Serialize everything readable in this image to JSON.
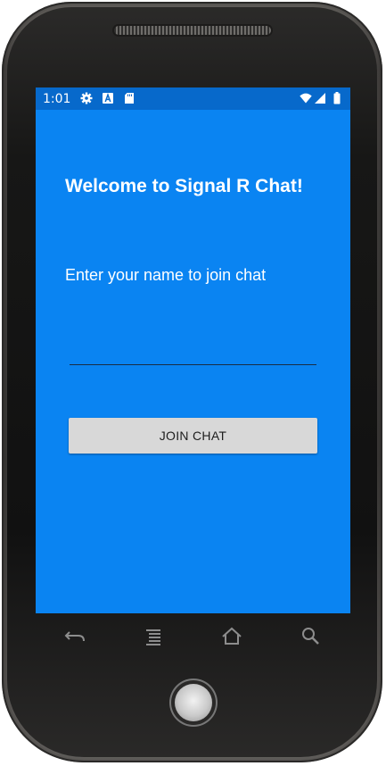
{
  "status_bar": {
    "time": "1:01",
    "left_icons": [
      "gear-icon",
      "font-a-icon",
      "sd-card-icon"
    ],
    "right_icons": [
      "wifi-icon",
      "signal-icon",
      "battery-icon"
    ]
  },
  "app": {
    "title": "Welcome to Signal R Chat!",
    "prompt": "Enter your name to join chat",
    "name_input": {
      "value": "",
      "placeholder": ""
    },
    "join_button_label": "JOIN CHAT"
  },
  "nav_bar": {
    "buttons": [
      "back-icon",
      "menu-icon",
      "home-icon",
      "search-icon"
    ]
  },
  "colors": {
    "background": "#0a84f2",
    "status_bar": "#0769cb",
    "button": "#d8d8d8"
  }
}
